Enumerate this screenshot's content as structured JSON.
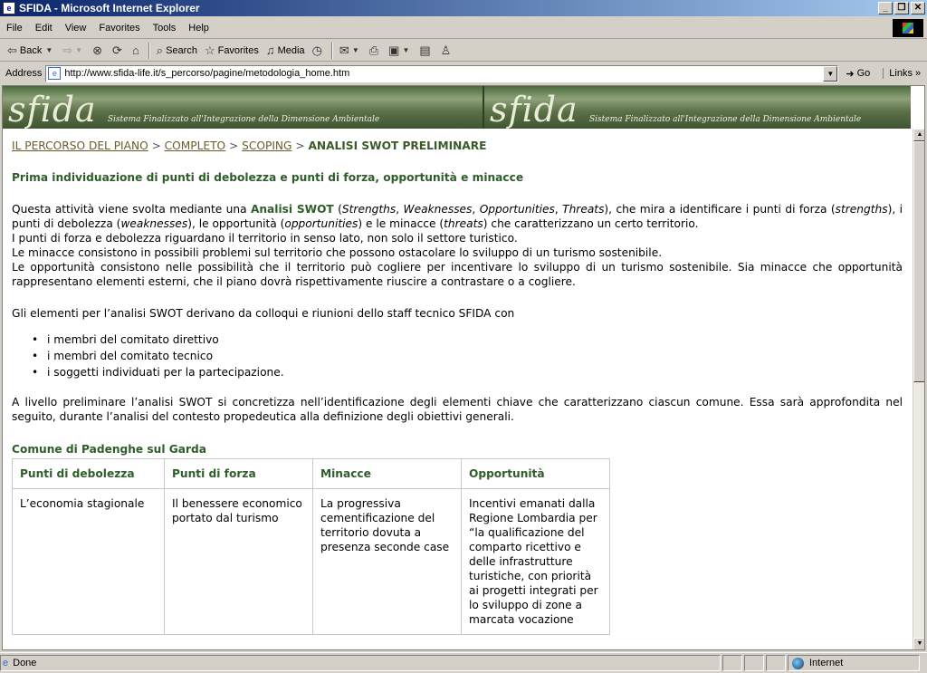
{
  "window": {
    "title": "SFIDA - Microsoft Internet Explorer"
  },
  "menu": [
    "File",
    "Edit",
    "View",
    "Favorites",
    "Tools",
    "Help"
  ],
  "toolbar": {
    "back": "Back",
    "search": "Search",
    "favorites": "Favorites",
    "media": "Media"
  },
  "address": {
    "label": "Address",
    "url": "http://www.sfida-life.it/s_percorso/pagine/metodologia_home.htm",
    "go": "Go",
    "links": "Links"
  },
  "banner": {
    "logo": "sfida",
    "tagline": "Sistema Finalizzato all'Integrazione della Dimensione Ambientale"
  },
  "breadcrumb": {
    "items": [
      "IL PERCORSO DEL PIANO",
      "COMPLETO",
      "SCOPING"
    ],
    "separator": ">",
    "current": "ANALISI SWOT PRELIMINARE"
  },
  "heading": "Prima individuazione di punti di debolezza e punti di forza, opportunità e minacce",
  "intro": {
    "p1_a": "Questa attività viene svolta mediante una ",
    "p1_bold": "Analisi SWOT",
    "p1_b": " (",
    "strengths": "Strengths",
    "comma1": ", ",
    "weaknesses": "Weaknesses",
    "comma2": ", ",
    "opportunities": "Opportunities",
    "comma3": ", ",
    "threats": "Threats",
    "p1_c": "), che mira a identificare i punti di forza (",
    "strengths_l": "strengths",
    "p1_d": "), i punti di debolezza (",
    "weaknesses_l": "weaknesses",
    "p1_e": "), le opportunità (",
    "opportunities_l": "opportunities",
    "p1_f": ") e le minacce (",
    "threats_l": "threats",
    "p1_g": ") che caratterizzano un certo territorio.",
    "line2": "I punti di forza e debolezza riguardano il territorio in senso lato, non solo il settore turistico.",
    "line3": "Le minacce consistono in possibili problemi sul territorio che possono ostacolare lo sviluppo di un turismo sostenibile.",
    "line4": "Le opportunità consistono nelle possibilità che il territorio può cogliere per incentivare lo sviluppo di un turismo sostenibile. Sia minacce che opportunità rappresentano elementi esterni, che il piano dovrà rispettivamente riuscire a contrastare o a cogliere."
  },
  "elements_intro": "Gli elementi per l’analisi SWOT derivano da colloqui e riunioni dello staff tecnico SFIDA con",
  "bullets": [
    "i membri del comitato direttivo",
    "i membri del comitato tecnico",
    "i soggetti individuati per la partecipazione."
  ],
  "preliminary": "A livello preliminare l’analisi SWOT si concretizza nell’identificazione degli elementi chiave che caratterizzano ciascun comune. Essa sarà approfondita nel seguito, durante l’analisi del contesto propedeutica alla definizione degli obiettivi generali.",
  "comune": "Comune di Padenghe sul Garda",
  "table": {
    "headers": [
      "Punti di debolezza",
      "Punti di forza",
      "Minacce",
      "Opportunità"
    ],
    "row": [
      "L’economia stagionale",
      "Il benessere economico portato dal turismo",
      "La progressiva cementificazione del territorio dovuta a presenza seconde case",
      "Incentivi emanati dalla Regione Lombardia per “la qualificazione del comparto ricettivo e delle infrastrutture turistiche, con priorità ai progetti integrati per lo sviluppo di zone a marcata vocazione"
    ]
  },
  "status": {
    "text": "Done",
    "zone": "Internet"
  }
}
